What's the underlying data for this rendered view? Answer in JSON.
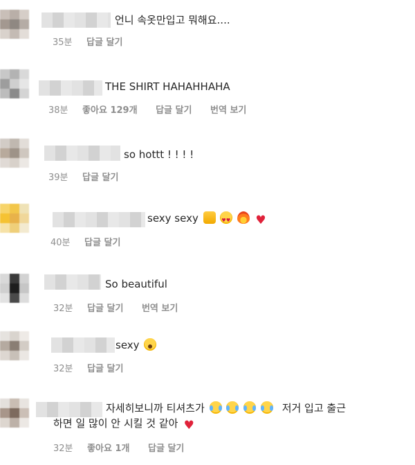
{
  "labels": {
    "reply": "답글 달기",
    "translate": "번역 보기"
  },
  "comments": [
    {
      "text": "언니 속옷만입고 뭐해요....",
      "time": "35분",
      "likes": "",
      "translate": false
    },
    {
      "text": "THE SHIRT HAHAHHAHA",
      "time": "38분",
      "likes": "좋아요 129개",
      "translate": true
    },
    {
      "text": "so hottt ! ! ! !",
      "time": "39분",
      "likes": "",
      "translate": false
    },
    {
      "text": "sexy sexy",
      "time": "40분",
      "likes": "",
      "translate": false,
      "emojis": [
        "raising-hands-icon",
        "heart-eyes-icon",
        "fire-icon",
        "red-heart-icon"
      ]
    },
    {
      "text": "So beautiful",
      "time": "32분",
      "likes": "",
      "translate": true
    },
    {
      "text": "sexy",
      "time": "32분",
      "likes": "",
      "translate": false,
      "emojis": [
        "hushed-face-icon"
      ]
    },
    {
      "text_line1": "자세히보니까 티셔츠가",
      "text_line1_after": "저거 입고 출근",
      "text_line2": "하면 일 많이 안 시킬 것 같아",
      "time": "32분",
      "likes": "좋아요 1개",
      "translate": false,
      "emojis": [
        "tears-of-joy-icon",
        "tears-of-joy-icon",
        "tears-of-joy-icon",
        "tears-of-joy-icon",
        "red-heart-icon"
      ]
    }
  ]
}
